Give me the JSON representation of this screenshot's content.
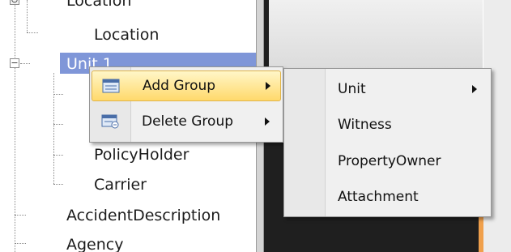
{
  "tree": {
    "items": [
      {
        "label": "Location"
      },
      {
        "label": "Location"
      },
      {
        "label": "Unit 1"
      },
      {
        "label": "PolicyHolder"
      },
      {
        "label": "Carrier"
      },
      {
        "label": "AccidentDescription"
      },
      {
        "label": "Agency"
      }
    ]
  },
  "context_menu": {
    "items": [
      {
        "label": "Add Group",
        "icon": "add-group-icon",
        "has_submenu": true
      },
      {
        "label": "Delete Group",
        "icon": "delete-group-icon",
        "has_submenu": true
      }
    ]
  },
  "submenu": {
    "items": [
      {
        "label": "Unit",
        "has_submenu": true
      },
      {
        "label": "Witness"
      },
      {
        "label": "PropertyOwner"
      },
      {
        "label": "Attachment"
      }
    ]
  },
  "colors": {
    "selection": "#7f96d8",
    "menu_highlight": "#ffd96b",
    "accent_orange": "#f0a04c"
  }
}
